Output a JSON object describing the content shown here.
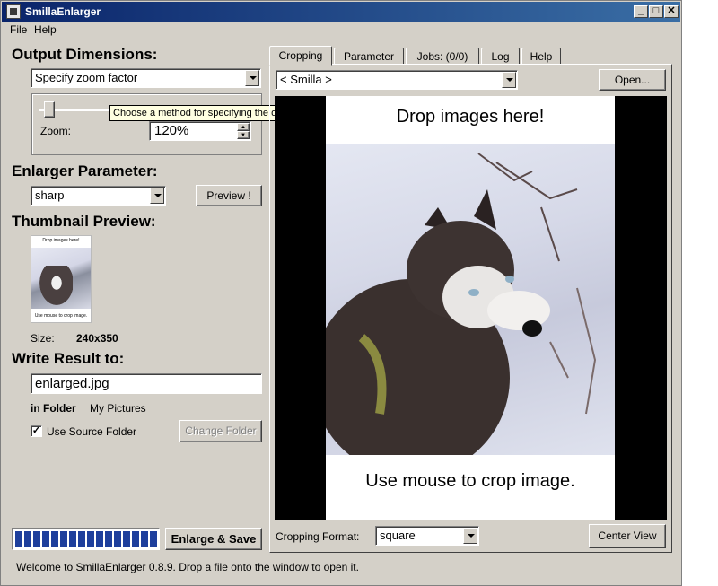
{
  "window": {
    "title": "SmillaEnlarger"
  },
  "menu": [
    "File",
    "Help"
  ],
  "output": {
    "title": "Output Dimensions:",
    "method_value": "Specify zoom factor",
    "zoom_label": "Zoom:",
    "zoom_value": "120%",
    "tooltip": "Choose a method for specifying the output dimensions",
    "slider_level": 0.05
  },
  "enlarger": {
    "title": "Enlarger Parameter:",
    "preset_value": "sharp",
    "preview_button": "Preview !"
  },
  "thumbnail": {
    "title": "Thumbnail Preview:",
    "top_text": "Drop images here!",
    "bottom_text": "Use mouse to crop image.",
    "size_label": "Size:",
    "size_value": "240x350"
  },
  "write": {
    "title": "Write Result to:",
    "filename": "enlarged.jpg",
    "folder_label": "in Folder",
    "folder_value": "My Pictures",
    "use_source_label": "Use Source Folder",
    "use_source_checked": true,
    "change_folder_button": "Change Folder"
  },
  "progress": {
    "segments": 16,
    "fraction": 1.0,
    "color": "#1e3f9c"
  },
  "enlarge_button": "Enlarge & Save",
  "status": "Welcome to SmillaEnlarger 0.8.9.  Drop a file onto the window to open it.",
  "tabs": [
    "Cropping",
    "Parameter",
    "Jobs: (0/0)",
    "Log",
    "Help"
  ],
  "active_tab": "Cropping",
  "image_select_value": "< Smilla >",
  "open_button": "Open...",
  "preview": {
    "top_text": "Drop images here!",
    "bottom_text": "Use mouse to crop image."
  },
  "cropping": {
    "label": "Cropping Format:",
    "value": "square",
    "center_button": "Center View"
  },
  "colors": {
    "title_start": "#0a246a",
    "title_end": "#3a6ea5",
    "face": "#d4d0c8",
    "progress": "#1e3f9c",
    "tooltip_bg": "#ffffe1"
  }
}
